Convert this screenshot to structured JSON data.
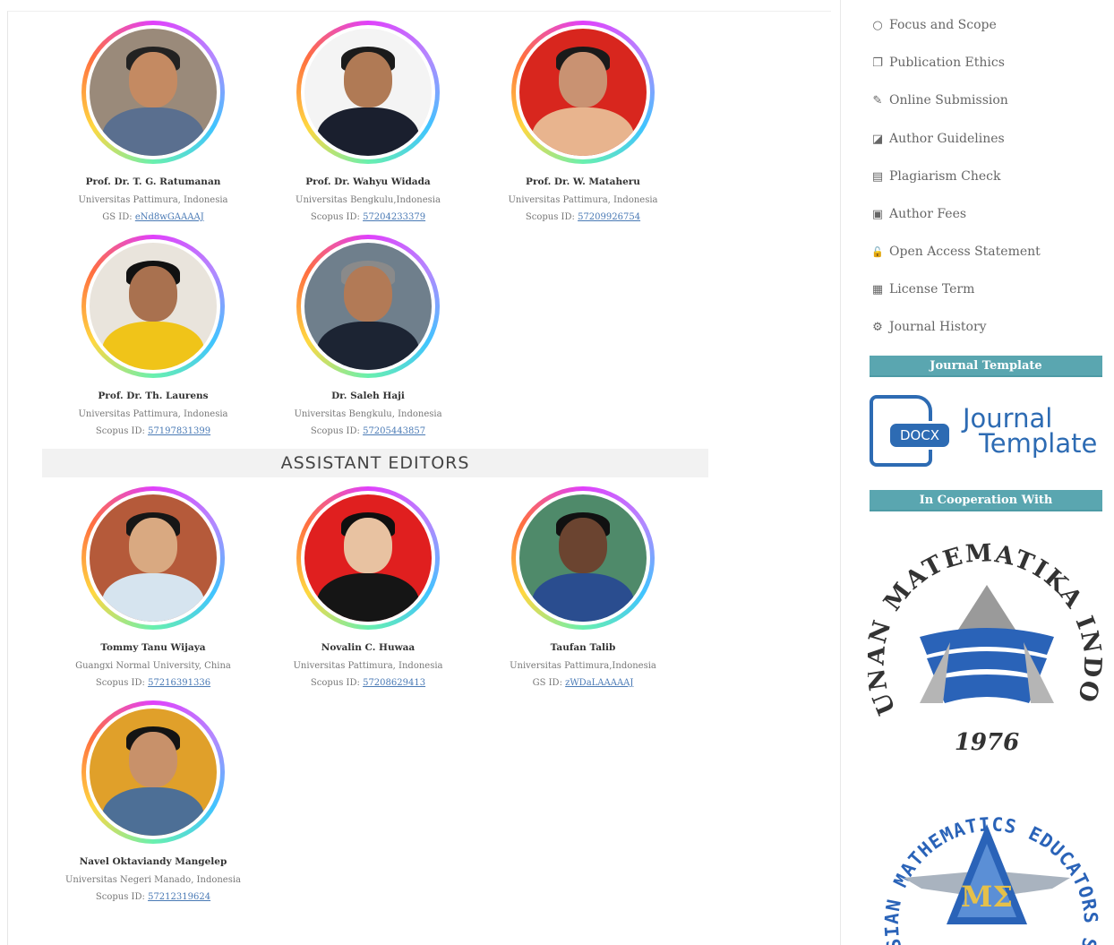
{
  "editors": [
    {
      "name": "Prof. Dr. T. G. Ratumanan",
      "affiliation": "Universitas Pattimura, Indonesia",
      "id_label": "GS ID:",
      "id_value": "eNd8wGAAAAJ"
    },
    {
      "name": "Prof. Dr. Wahyu Widada",
      "affiliation": "Universitas Bengkulu,Indonesia",
      "id_label": "Scopus ID:",
      "id_value": "57204233379"
    },
    {
      "name": "Prof. Dr. W. Mataheru",
      "affiliation": "Universitas Pattimura, Indonesia",
      "id_label": "Scopus ID:",
      "id_value": "57209926754"
    },
    {
      "name": "Prof. Dr. Th. Laurens",
      "affiliation": "Universitas Pattimura, Indonesia",
      "id_label": "Scopus ID:",
      "id_value": "57197831399"
    },
    {
      "name": "Dr. Saleh Haji",
      "affiliation": "Universitas Bengkulu, Indonesia",
      "id_label": "Scopus ID:",
      "id_value": "57205443857"
    }
  ],
  "assistant_section_title": "ASSISTANT EDITORS",
  "assistant_editors": [
    {
      "name": "Tommy Tanu Wijaya",
      "affiliation": "Guangxi Normal University, China",
      "id_label": "Scopus ID:",
      "id_value": "57216391336"
    },
    {
      "name": "Novalin C. Huwaa",
      "affiliation": "Universitas Pattimura, Indonesia",
      "id_label": "Scopus ID:",
      "id_value": "57208629413"
    },
    {
      "name": "Taufan Talib",
      "affiliation": "Universitas Pattimura,Indonesia",
      "id_label": "GS ID:",
      "id_value": "zWDaLAAAAAJ"
    },
    {
      "name": "Navel Oktaviandy Mangelep",
      "affiliation": "Universitas Negeri Manado, Indonesia",
      "id_label": "Scopus ID:",
      "id_value": "57212319624"
    }
  ],
  "sidebar": {
    "menu": [
      {
        "icon": "circle-icon",
        "glyph": "○",
        "label": "Focus and Scope"
      },
      {
        "icon": "copy-icon",
        "glyph": "❐",
        "label": "Publication Ethics"
      },
      {
        "icon": "edit-icon",
        "glyph": "✎",
        "label": "Online Submission"
      },
      {
        "icon": "book-icon",
        "glyph": "◪",
        "label": "Author Guidelines"
      },
      {
        "icon": "list-icon",
        "glyph": "▤",
        "label": "Plagiarism Check"
      },
      {
        "icon": "money-icon",
        "glyph": "▣",
        "label": "Author Fees"
      },
      {
        "icon": "unlock-icon",
        "glyph": "🔓",
        "label": "Open Access Statement"
      },
      {
        "icon": "license-icon",
        "glyph": "▦",
        "label": "License Term"
      },
      {
        "icon": "gears-icon",
        "glyph": "⚙",
        "label": "Journal History"
      }
    ],
    "template_header": "Journal Template",
    "template_logo": {
      "badge": "DOCX",
      "line1": "Journal",
      "line2": "Template"
    },
    "cooperation_header": "In Cooperation With",
    "himpunan_logo": {
      "arc_text": "HIMPUNAN MATEMATIKA INDONESIA",
      "year": "1976"
    },
    "imes_logo": {
      "arc_text": "INDONESIAN MATHEMATICS EDUCATORS SOCIETY",
      "mark": "MΣ"
    }
  },
  "colors": {
    "accent_teal": "#5aa6b0",
    "link_blue": "#4a7ab5",
    "logo_blue": "#2d6bb3"
  }
}
